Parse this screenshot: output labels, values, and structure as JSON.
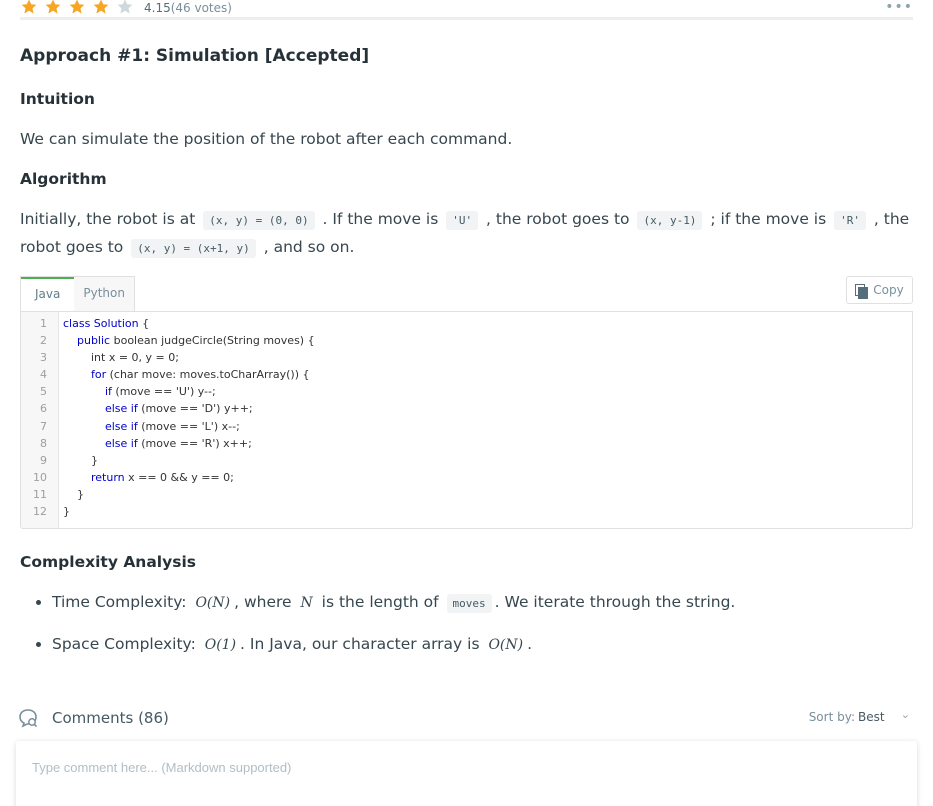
{
  "rating": {
    "stars_filled": 4,
    "stars_total": 5,
    "value": "4.15",
    "votes": "(46 votes)",
    "star_color": "#f5a623",
    "star_empty_color": "#cfd8dc"
  },
  "article": {
    "approach_title": "Approach #1: Simulation [Accepted]",
    "intuition_heading": "Intuition",
    "intuition_text": "We can simulate the position of the robot after each command.",
    "algorithm_heading": "Algorithm",
    "algo": {
      "t1": "Initially, the robot is at ",
      "c1": "(x, y) = (0, 0)",
      "t2": " . If the move is ",
      "c2": "'U'",
      "t3": " , the robot goes to ",
      "c3": "(x, y-1)",
      "t4": " ; if the move is ",
      "c4": "'R'",
      "t5": " , the robot goes to ",
      "c5": "(x, y) = (x+1, y)",
      "t6": " , and so on."
    }
  },
  "code": {
    "tabs": [
      "Java",
      "Python"
    ],
    "active_tab": "Java",
    "copy_label": "Copy",
    "line_numbers": [
      "1",
      "2",
      "3",
      "4",
      "5",
      "6",
      "7",
      "8",
      "9",
      "10",
      "11",
      "12"
    ],
    "lines": [
      {
        "kw": "class Solution",
        "rest": " {"
      },
      {
        "indent": "    ",
        "kw": "public",
        "rest": " boolean judgeCircle(String moves) {"
      },
      {
        "indent": "        ",
        "kw": "",
        "rest": "int x = 0, y = 0;"
      },
      {
        "indent": "        ",
        "kw": "for",
        "rest": " (char move: moves.toCharArray()) {"
      },
      {
        "indent": "            ",
        "kw": "if",
        "rest": " (move == 'U') y--;"
      },
      {
        "indent": "            ",
        "kw": "else if",
        "rest": " (move == 'D') y++;"
      },
      {
        "indent": "            ",
        "kw": "else if",
        "rest": " (move == 'L') x--;"
      },
      {
        "indent": "            ",
        "kw": "else if",
        "rest": " (move == 'R') x++;"
      },
      {
        "indent": "        ",
        "kw": "",
        "rest": "}"
      },
      {
        "indent": "        ",
        "kw": "return",
        "rest": " x == 0 && y == 0;"
      },
      {
        "indent": "    ",
        "kw": "",
        "rest": "}"
      },
      {
        "indent": "",
        "kw": "",
        "rest": "}"
      }
    ]
  },
  "complexity": {
    "heading": "Complexity Analysis",
    "time_label": "Time Complexity: ",
    "time_math": "O(N)",
    "time_t1": ", where ",
    "time_var": "N",
    "time_t2": " is the length of ",
    "time_code": "moves",
    "time_t3": ". We iterate through the string.",
    "space_label": "Space Complexity: ",
    "space_math": "O(1)",
    "space_t1": ". In Java, our character array is ",
    "space_math2": "O(N)",
    "space_t2": "."
  },
  "comments": {
    "title": "Comments (86)",
    "sort_label": "Sort by:",
    "sort_value": "Best",
    "input_placeholder": "Type comment here... (Markdown supported)"
  }
}
